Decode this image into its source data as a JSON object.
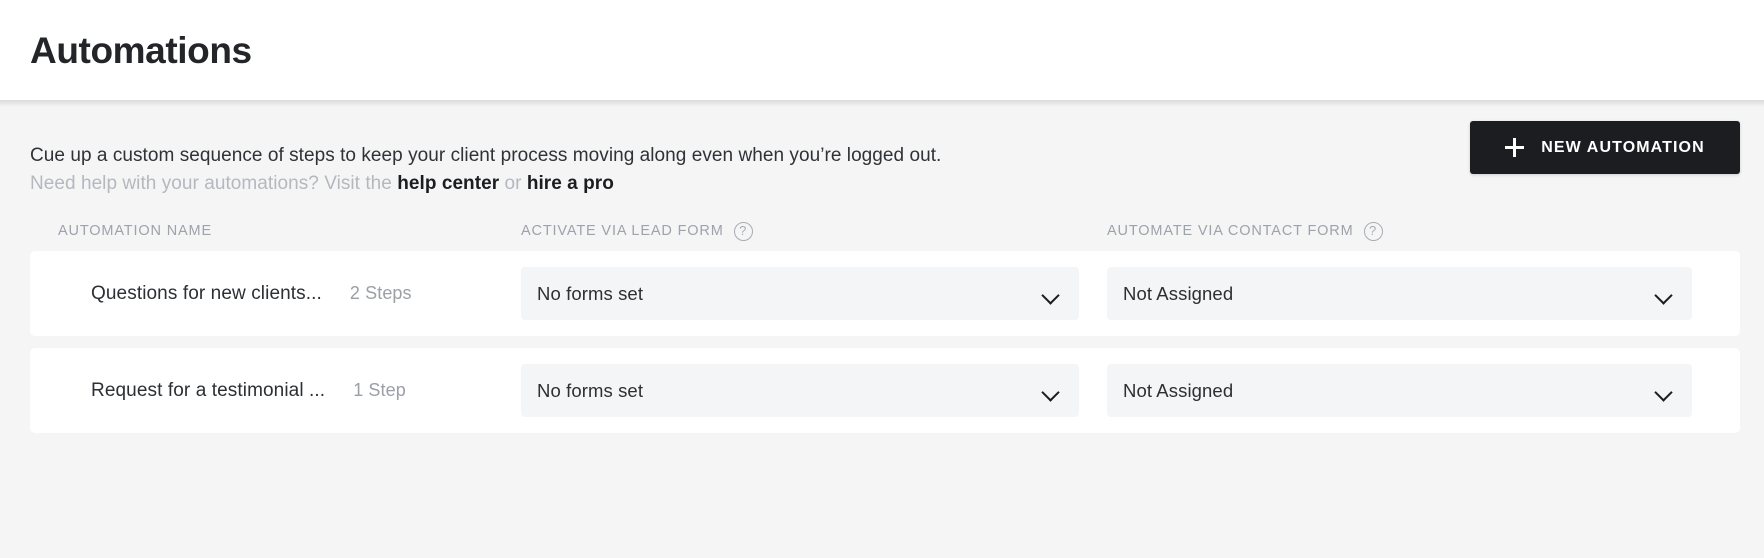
{
  "header": {
    "title": "Automations"
  },
  "intro": {
    "line1": "Cue up a custom sequence of steps to keep your client process moving along even when you’re logged out.",
    "line2_prefix": "Need help with your automations? Visit the ",
    "link_help_center": "help center",
    "line2_middle": " or ",
    "link_hire_a_pro": "hire a pro"
  },
  "actions": {
    "new_automation_label": "NEW AUTOMATION",
    "new_automation_icon": "plus-icon",
    "new_automation_bg": "#1b1d21"
  },
  "table": {
    "columns": [
      {
        "label": "AUTOMATION NAME",
        "has_help": false
      },
      {
        "label": "ACTIVATE VIA LEAD FORM",
        "has_help": true
      },
      {
        "label": "AUTOMATE VIA CONTACT FORM",
        "has_help": true
      }
    ],
    "help_glyph": "?",
    "rows": [
      {
        "name": "Questions for new clients...",
        "steps": "2 Steps",
        "lead_form": "No forms set",
        "contact_form": "Not Assigned"
      },
      {
        "name": "Request for a testimonial ...",
        "steps": "1 Step",
        "lead_form": "No forms set",
        "contact_form": "Not Assigned"
      }
    ]
  },
  "colors": {
    "page_bg": "#f5f5f5",
    "card_bg": "#ffffff",
    "select_bg": "#f4f5f6",
    "muted_text": "#9ea2ab",
    "primary_text": "#1b1d21"
  }
}
